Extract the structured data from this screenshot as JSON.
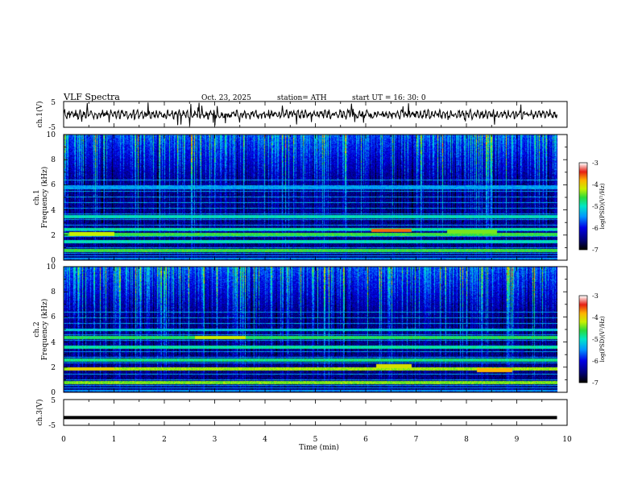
{
  "header": {
    "title": "VLF  Spectra",
    "date": "Oct. 23, 2025",
    "station": "station= ATH",
    "start": "start  UT  =   16: 30: 0"
  },
  "chart_data": [
    {
      "type": "line",
      "panel": "ch1-waveform",
      "ylabel": "ch.1(V)",
      "ylim": [
        -5,
        5
      ],
      "yticks": [
        "5",
        "-5"
      ],
      "xlim": [
        0,
        10
      ],
      "data_extent_min": [
        0,
        9.8
      ],
      "level_v": 0,
      "color": "#000000"
    },
    {
      "type": "heatmap",
      "panel": "ch1-spectrogram",
      "ylabel_line1": "ch.1",
      "ylabel_line2": "Frequency (kHz)",
      "ylim": [
        0,
        10
      ],
      "yticks": [
        "0",
        "2",
        "4",
        "6",
        "8",
        "10"
      ],
      "xlim": [
        0,
        10
      ],
      "data_extent_min": [
        0,
        9.8
      ],
      "colorbar": {
        "label": "log(PSD)(V²/Hz)",
        "range": [
          -7,
          -3
        ],
        "ticks": [
          "-3",
          "-4",
          "-5",
          "-6",
          "-7"
        ]
      },
      "bands_khz": [
        {
          "f": 0.8,
          "level": -4.6
        },
        {
          "f": 1.5,
          "level": -5.0
        },
        {
          "f": 2.1,
          "level": -4.6
        },
        {
          "f": 2.5,
          "level": -4.9
        },
        {
          "f": 3.5,
          "level": -5.0
        },
        {
          "f": 5.8,
          "level": -5.4
        }
      ],
      "events": [
        {
          "t_start": 0.1,
          "t_end": 1.0,
          "f": 2.1,
          "level": -4.2
        },
        {
          "t_start": 6.1,
          "t_end": 6.9,
          "f": 2.4,
          "level": -3.6
        },
        {
          "t_start": 7.6,
          "t_end": 8.6,
          "f": 2.3,
          "level": -4.4
        }
      ]
    },
    {
      "type": "heatmap",
      "panel": "ch2-spectrogram",
      "ylabel_line1": "ch.2",
      "ylabel_line2": "Frequency (kHz)",
      "ylim": [
        0,
        10
      ],
      "yticks": [
        "0",
        "2",
        "4",
        "6",
        "8",
        "10"
      ],
      "xlim": [
        0,
        10
      ],
      "data_extent_min": [
        0,
        9.8
      ],
      "colorbar": {
        "label": "log(PSD)(V²/Hz)",
        "range": [
          -7,
          -3
        ],
        "ticks": [
          "-3",
          "-4",
          "-5",
          "-6",
          "-7"
        ]
      },
      "bands_khz": [
        {
          "f": 0.8,
          "level": -4.4
        },
        {
          "f": 1.9,
          "level": -4.3
        },
        {
          "f": 2.6,
          "level": -4.8
        },
        {
          "f": 3.6,
          "level": -4.9
        },
        {
          "f": 4.4,
          "level": -4.7
        },
        {
          "f": 5.0,
          "level": -5.2
        }
      ],
      "events": [
        {
          "t_start": 0.1,
          "t_end": 1.0,
          "f": 1.9,
          "level": -4.0
        },
        {
          "t_start": 2.6,
          "t_end": 3.6,
          "f": 4.4,
          "level": -4.2
        },
        {
          "t_start": 6.2,
          "t_end": 6.9,
          "f": 2.1,
          "level": -4.1
        },
        {
          "t_start": 8.2,
          "t_end": 8.9,
          "f": 1.8,
          "level": -3.8
        }
      ]
    },
    {
      "type": "line",
      "panel": "ch3-waveform",
      "ylabel": "ch.3(V)",
      "ylim": [
        -5,
        5
      ],
      "yticks": [
        "5",
        "-5"
      ],
      "xlim": [
        0,
        10
      ],
      "data_extent_min": [
        0,
        9.8
      ],
      "level_v": -2,
      "color": "#000000"
    }
  ],
  "x_axis": {
    "label": "Time  (min)",
    "ticks": [
      "0",
      "1",
      "2",
      "3",
      "4",
      "5",
      "6",
      "7",
      "8",
      "9",
      "10"
    ]
  }
}
